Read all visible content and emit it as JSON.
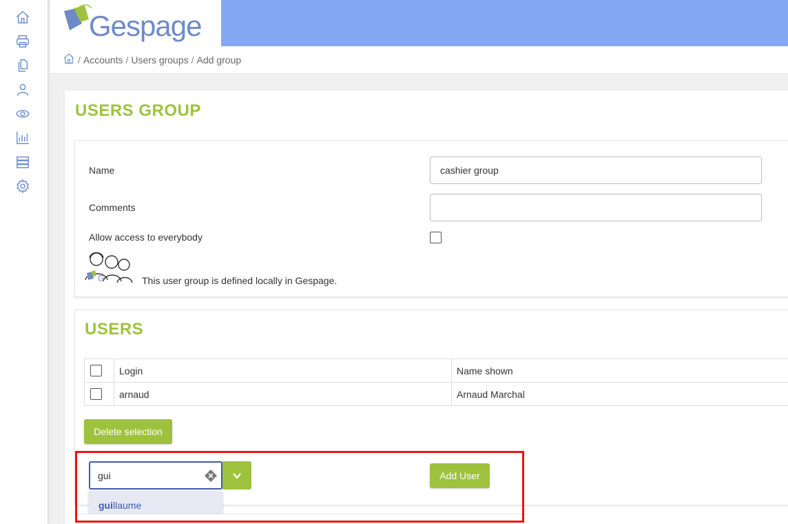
{
  "brand": {
    "logo_text": "Gespage",
    "accent": "#9fc23e",
    "topbar_color": "#84a8f2"
  },
  "sidebar": {
    "items": [
      {
        "icon": "home-icon"
      },
      {
        "icon": "printer-icon"
      },
      {
        "icon": "documents-icon"
      },
      {
        "icon": "user-icon"
      },
      {
        "icon": "eye-icon"
      },
      {
        "icon": "bar-chart-icon"
      },
      {
        "icon": "server-icon"
      },
      {
        "icon": "gear-icon"
      }
    ]
  },
  "breadcrumb": {
    "items": [
      "Accounts",
      "Users groups",
      "Add group"
    ],
    "separator": "/"
  },
  "group_section": {
    "title": "USERS GROUP",
    "name_label": "Name",
    "name_value": "cashier group",
    "comments_label": "Comments",
    "comments_value": "",
    "allow_label": "Allow access to everybody",
    "local_note": "This user group is defined locally in Gespage."
  },
  "users_section": {
    "title": "USERS",
    "columns": [
      "Login",
      "Name shown"
    ],
    "rows": [
      {
        "login": "arnaud",
        "name_shown": "Arnaud Marchal"
      }
    ],
    "delete_label": "Delete selection",
    "add_user_label": "Add User",
    "search_value": "gui",
    "suggestion_match": "gui",
    "suggestion_rest": "llaume"
  }
}
